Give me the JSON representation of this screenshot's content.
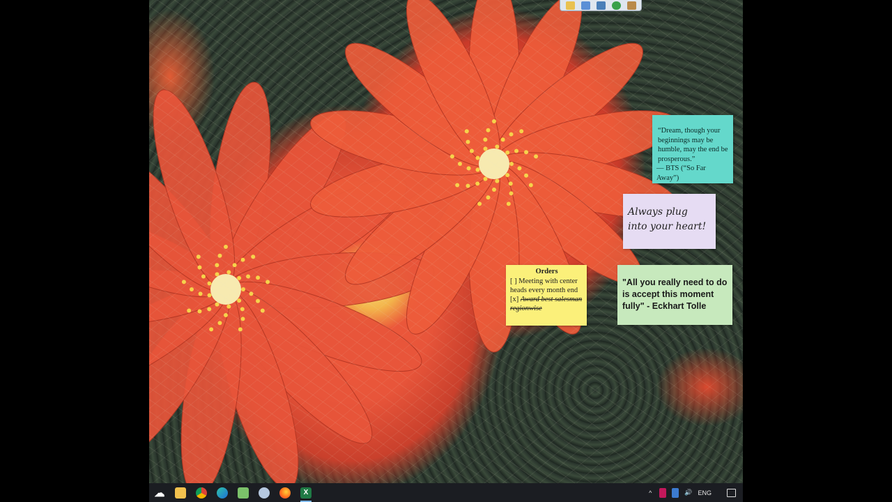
{
  "desktop": {
    "wallpaper": "red cactus flowers",
    "colors": {
      "petal": "#e8553a",
      "stamen": "#f6d24a",
      "cactus": "#24302a"
    }
  },
  "quickbar": {
    "icons": [
      "folder-icon",
      "document-icon",
      "window-icon",
      "globe-icon",
      "notebook-icon"
    ]
  },
  "notes": {
    "quote": {
      "color": "#64d8cb",
      "text": "“Dream, though your beginnings may be humble, may the end be prosperous.”",
      "attribution": "— BTS (“So Far Away”)"
    },
    "heart": {
      "color": "#e6dcf3",
      "line1": "Always plug",
      "line2": "into your heart!"
    },
    "orders": {
      "color": "#fbf07a",
      "title": "Orders",
      "item1": "[ ] Meeting with center heads every month end",
      "item2_box": "[x] ",
      "item2_text": "Award best salesman regionwise"
    },
    "tolle": {
      "color": "#c7e9bd",
      "text": "\"All you really need to do is accept this moment fully\" - Eckhart Tolle"
    }
  },
  "taskbar": {
    "apps": [
      {
        "name": "start-button",
        "icon": "onedrive-cloud-icon",
        "glyph": "☁",
        "color": "#ffffff"
      },
      {
        "name": "file-explorer",
        "icon": "folder-icon",
        "glyph": "",
        "color": "#f2c14e"
      },
      {
        "name": "chrome",
        "icon": "chrome-icon",
        "glyph": "",
        "color": "#4caf50"
      },
      {
        "name": "edge",
        "icon": "edge-icon",
        "glyph": "",
        "color": "#1e8ed8"
      },
      {
        "name": "notepad-plus",
        "icon": "notepad-icon",
        "glyph": "",
        "color": "#6dbb5a"
      },
      {
        "name": "paint",
        "icon": "paint-icon",
        "glyph": "",
        "color": "#9db6d6"
      },
      {
        "name": "firefox",
        "icon": "firefox-icon",
        "glyph": "",
        "color": "#ff7a1a"
      },
      {
        "name": "excel",
        "icon": "excel-icon",
        "glyph": "X",
        "color": "#1f7a45"
      }
    ],
    "tray": {
      "chevron": "^",
      "lang": "ENG"
    }
  }
}
